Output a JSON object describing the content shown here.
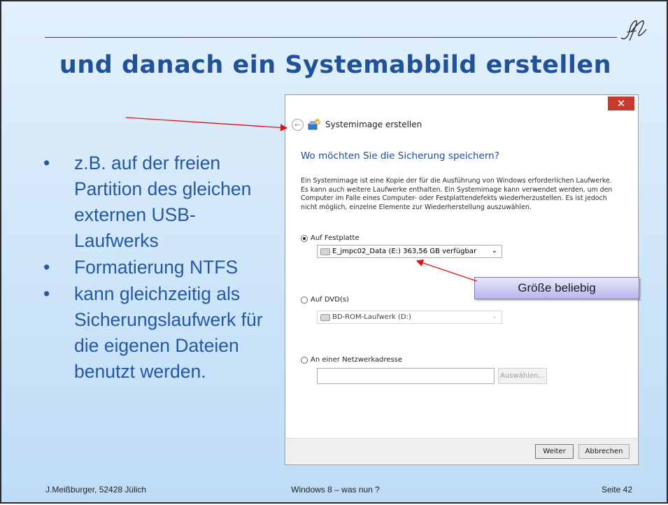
{
  "slide": {
    "title": "und danach ein Systemabbild erstellen",
    "bullets": [
      "z.B. auf der freien Partition des gleichen externen USB-Laufwerks",
      "Formatierung NTFS",
      "kann gleichzeitig als Sicherungslaufwerk für die eigenen Dateien benutzt werden."
    ],
    "bullet_symbol": "•",
    "callout": "Größe beliebig",
    "footer": {
      "left": "J.Meißburger, 52428 Jülich",
      "center": "Windows 8 – was nun ?",
      "right": "Seite 42"
    },
    "colors": {
      "title": "#20529a",
      "bullets": "#2457a4",
      "arrow": "#e01010"
    }
  },
  "dialog": {
    "close_glyph": "✕",
    "back_glyph": "←",
    "window_title": "Systemimage erstellen",
    "heading": "Wo möchten Sie die Sicherung speichern?",
    "description": "Ein Systemimage ist eine Kopie der für die Ausführung von Windows erforderlichen Laufwerke. Es kann auch weitere Laufwerke enthalten. Ein Systemimage kann verwendet werden, um den Computer im Falle eines Computer- oder Festplattendefekts wiederherzustellen. Es ist jedoch nicht möglich, einzelne Elemente zur Wiederherstellung auszuwählen.",
    "options": [
      {
        "label": "Auf Festplatte",
        "selected": true
      },
      {
        "label": "Auf DVD(s)",
        "selected": false
      },
      {
        "label": "An einer Netzwerkadresse",
        "selected": false
      }
    ],
    "hdd_select": "E_jmpc02_Data (E:)  363,56 GB verfügbar",
    "dvd_select": "BD-ROM-Laufwerk (D:)",
    "network_value": "",
    "browse_label": "Auswählen...",
    "next_label": "Weiter",
    "cancel_label": "Abbrechen",
    "chevron_glyph": "⌄"
  }
}
